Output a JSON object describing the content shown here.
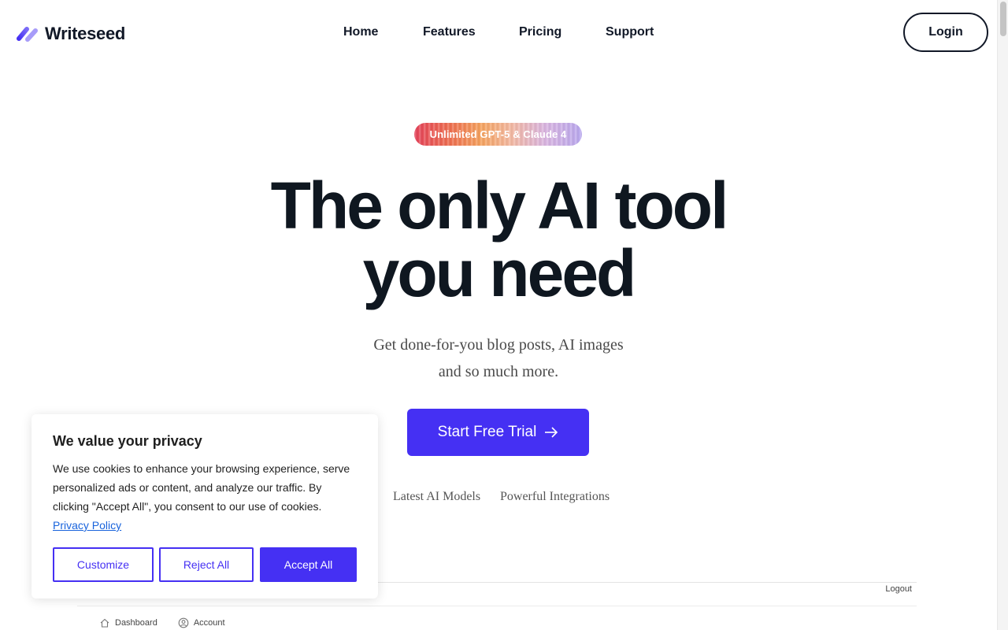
{
  "brand": {
    "name": "Writeseed",
    "accent": "#4530f3"
  },
  "nav": {
    "home": "Home",
    "features": "Features",
    "pricing": "Pricing",
    "support": "Support",
    "login": "Login"
  },
  "hero": {
    "badge": "Unlimited GPT-5 & Claude 4",
    "headline_line1": "The only AI tool",
    "headline_line2": "you need",
    "sub_line1": "Get done-for-you blog posts, AI images",
    "sub_line2": "and so much more.",
    "cta": "Start Free Trial",
    "feature_1": "Latest AI Models",
    "feature_2": "Powerful Integrations"
  },
  "preview": {
    "logout": "Logout",
    "nav_dashboard": "Dashboard",
    "nav_account": "Account"
  },
  "cookie": {
    "title": "We value your privacy",
    "body": "We use cookies to enhance your browsing experience, serve personalized ads or content, and analyze our traffic. By clicking \"Accept All\", you consent to our use of cookies.",
    "policy_link": "Privacy Policy",
    "customize": "Customize",
    "reject": "Reject All",
    "accept": "Accept All"
  }
}
